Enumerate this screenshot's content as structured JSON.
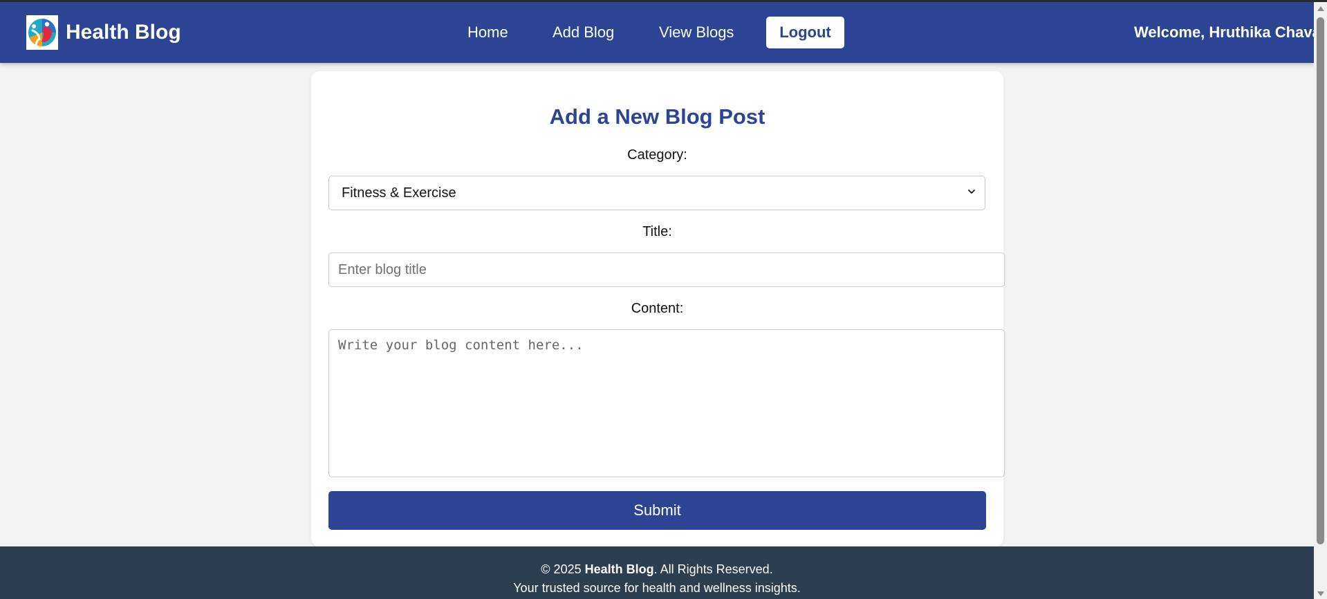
{
  "header": {
    "brand_name": "Health Blog",
    "logo_icon": "health-logo-icon",
    "nav": {
      "home": "Home",
      "add_blog": "Add Blog",
      "view_blogs": "View Blogs"
    },
    "logout_label": "Logout",
    "welcome_text": "Welcome, Hruthika Chavan"
  },
  "form": {
    "title": "Add a New Blog Post",
    "category_label": "Category:",
    "category_value": "Fitness & Exercise",
    "title_label": "Title:",
    "title_placeholder": "Enter blog title",
    "content_label": "Content:",
    "content_placeholder": "Write your blog content here...",
    "submit_label": "Submit"
  },
  "footer": {
    "copyright_prefix": "© 2025 ",
    "copyright_brand": "Health Blog",
    "copyright_suffix": ". All Rights Reserved.",
    "tagline": "Your trusted source for health and wellness insights."
  },
  "colors": {
    "primary": "#2d4393",
    "footer_bg": "#2c3e50",
    "page_bg": "#f3f3f3"
  }
}
